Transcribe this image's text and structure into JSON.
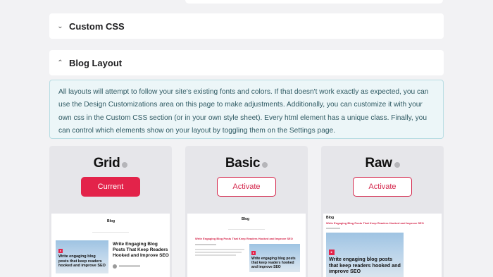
{
  "sections": {
    "custom_css": {
      "label": "Custom CSS",
      "chevron": "⌄"
    },
    "blog_layout": {
      "label": "Blog Layout",
      "chevron": "⌃"
    }
  },
  "info_text": "All layouts will attempt to follow your site's existing fonts and colors. If that doesn't work exactly as expected, you can use the Design Customizations area on this page to make adjustments. Additionally, you can customize it with your own css in the Custom CSS section (or in your own style sheet). Every html element has a unique class. Finally, you can control which elements show on your layout by toggling them on the Settings page.",
  "layouts": [
    {
      "name": "Grid",
      "button": "Current",
      "state": "current",
      "preview": {
        "blog_title": "Blog",
        "post_title": "Write Engaging Blog Posts That Keep Readers Hooked and Improve SEO",
        "image_text": "Write engaging blog posts that keep readers hooked and improve SEO"
      }
    },
    {
      "name": "Basic",
      "button": "Activate",
      "state": "inactive",
      "preview": {
        "blog_title": "Blog",
        "post_title": "Write Engaging Blog Posts That Keep Readers Hooked and Improve SEO",
        "image_text": "Write engaging blog posts that keep readers hooked and improve SEO"
      }
    },
    {
      "name": "Raw",
      "button": "Activate",
      "state": "inactive",
      "preview": {
        "blog_title": "Blog",
        "post_title": "Write Engaging Blog Posts That Keep Readers Hooked and Improve SEO",
        "image_text": "Write engaging blog posts that keep readers hooked and improve SEO"
      }
    }
  ],
  "colors": {
    "accent": "#e3234a",
    "info_bg": "#ecf6f8",
    "card_bg": "#e6e6ea"
  }
}
